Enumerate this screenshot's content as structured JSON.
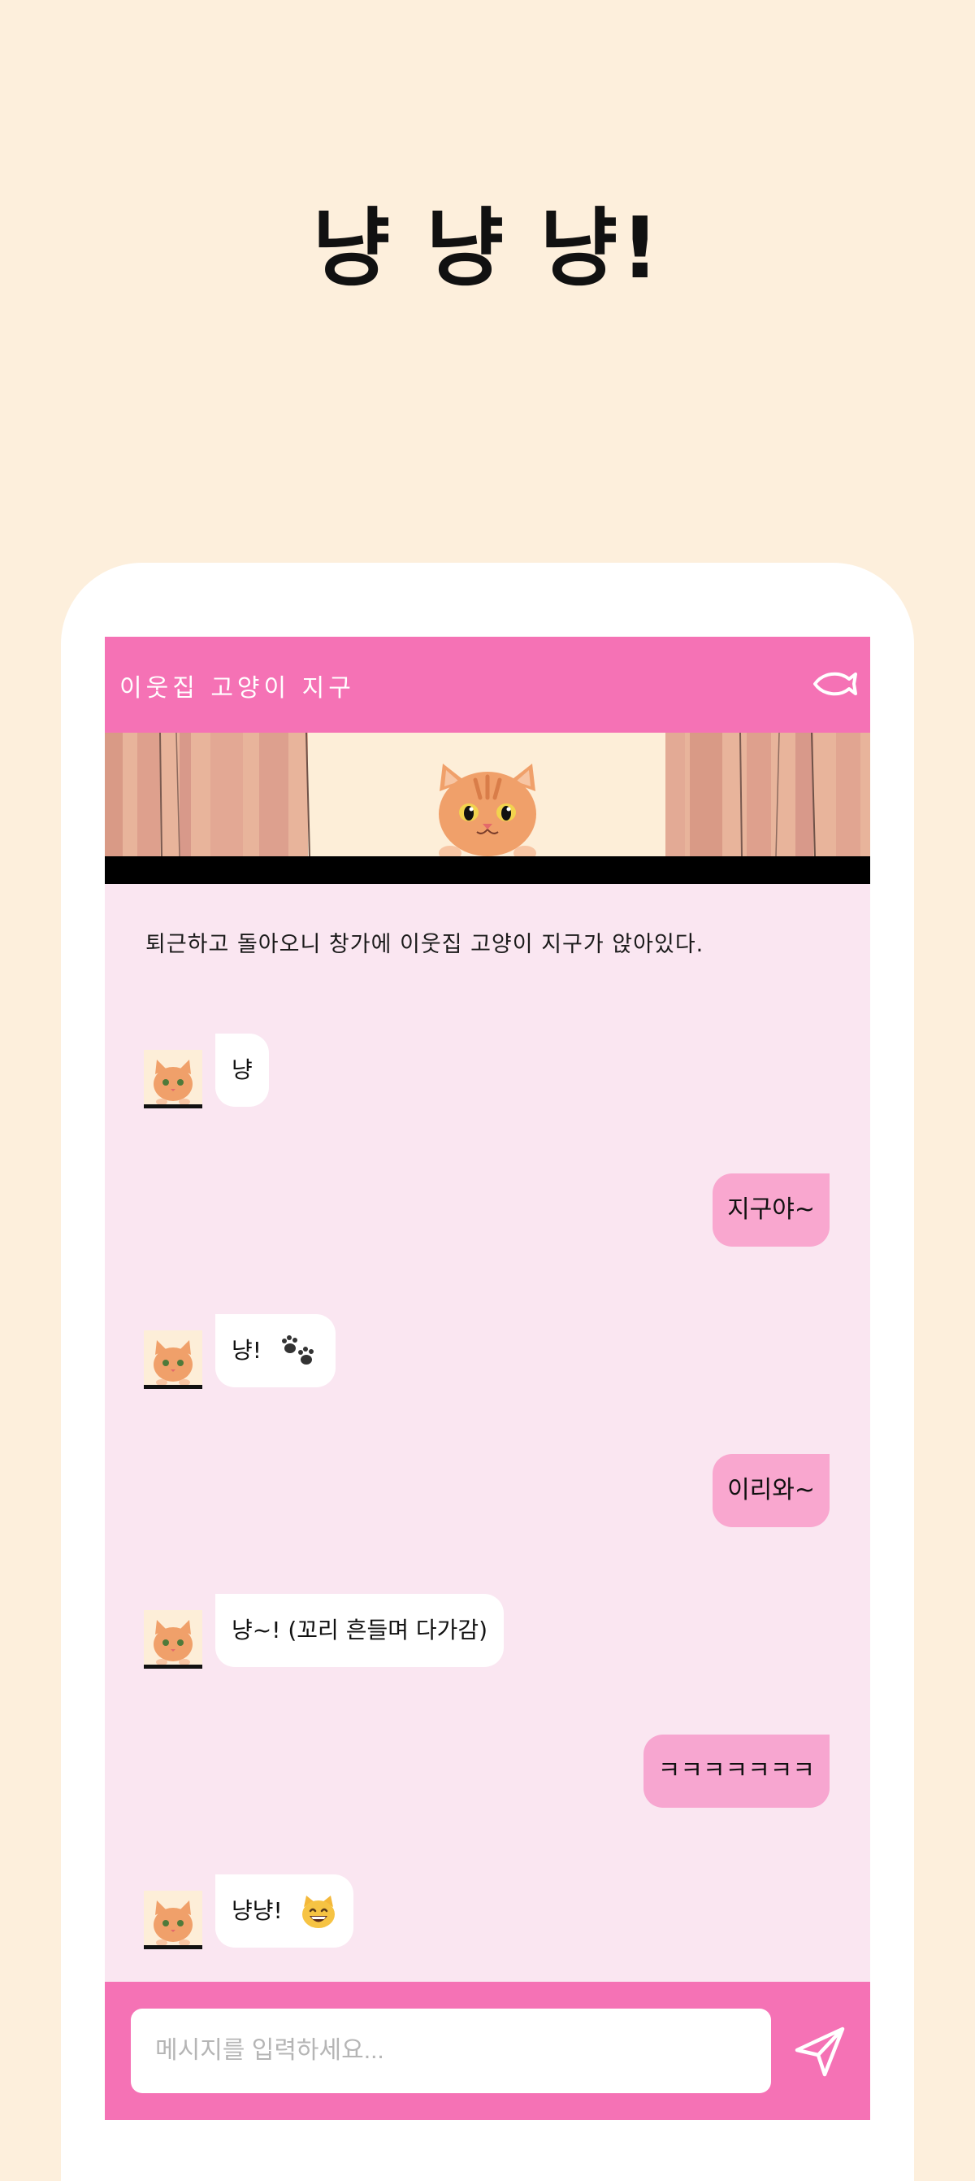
{
  "poster": {
    "title": "냥 냥 냥!"
  },
  "header": {
    "title": "이웃집 고양이 지구",
    "menu_icon": "fish-icon"
  },
  "narration": "퇴근하고 돌아오니 창가에 이웃집 고양이 지구가 앉아있다.",
  "messages": [
    {
      "from": "cat",
      "text": "냥"
    },
    {
      "from": "me",
      "text": "지구야~"
    },
    {
      "from": "cat",
      "text": "냥!",
      "icon": "paw-prints-icon"
    },
    {
      "from": "me",
      "text": "이리와~"
    },
    {
      "from": "cat",
      "text": "냥~! (꼬리 흔들며 다가감)"
    },
    {
      "from": "me",
      "text": "ㅋㅋㅋㅋㅋㅋㅋ"
    },
    {
      "from": "cat",
      "text": "냥냥!",
      "icon": "grinning-cat-emoji"
    }
  ],
  "composer": {
    "placeholder": "메시지를 입력하세요...",
    "send_icon": "send-icon"
  },
  "colors": {
    "background": "#fdefdc",
    "header": "#f572b5",
    "chat_background": "#fae6f1",
    "my_bubble_1": "#f9a7cf",
    "my_bubble_2": "#f7a6d0",
    "cat_bubble": "#ffffff"
  }
}
